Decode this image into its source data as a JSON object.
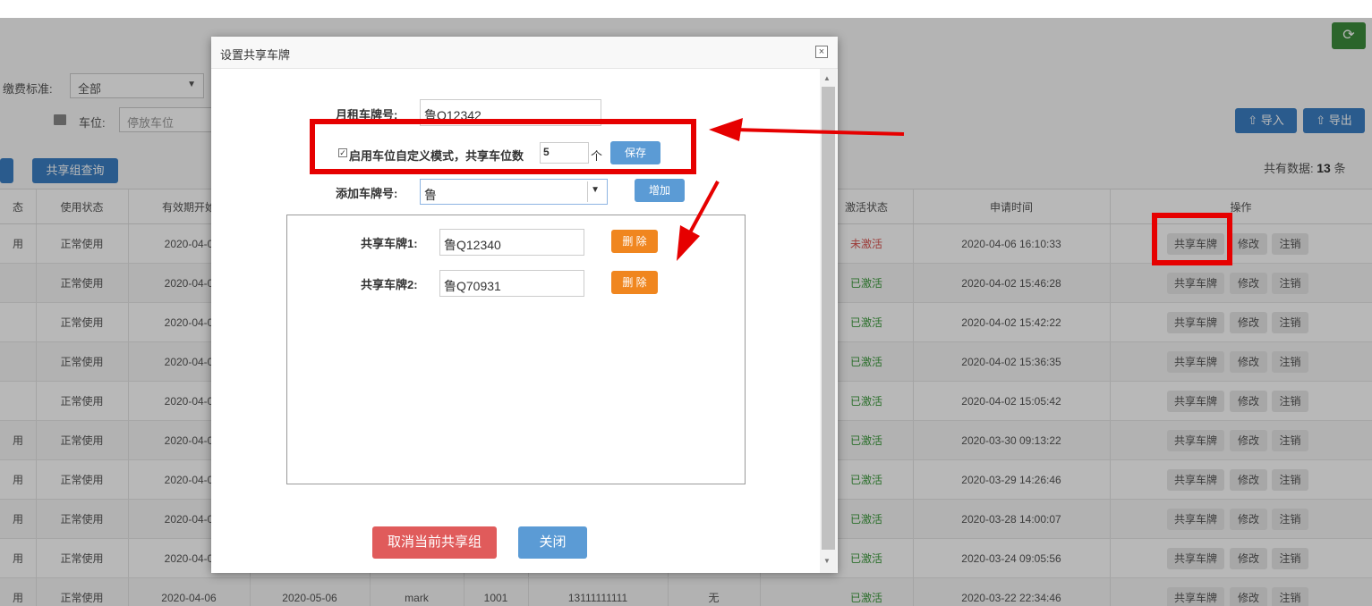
{
  "filters": {
    "fee_label": "缴费标准:",
    "fee_value": "全部",
    "space_label": "车位:",
    "space_placeholder": "停放车位"
  },
  "toolbar": {
    "group_query": "共享组查询",
    "import": "导入",
    "export": "导出",
    "total_label": "共有数据:",
    "total_count": "13",
    "total_unit": "条"
  },
  "table": {
    "headers": {
      "status_fragment": "态",
      "use_status": "使用状态",
      "valid_start": "有效期开始",
      "activation": "激活状态",
      "apply_time": "申请时间",
      "ops": "操作"
    },
    "rows": [
      {
        "f": "用",
        "use": "正常使用",
        "start": "2020-04-0",
        "act": "未激活",
        "act_color": "red",
        "time": "2020-04-06 16:10:33"
      },
      {
        "f": "",
        "use": "正常使用",
        "start": "2020-04-0",
        "act": "已激活",
        "act_color": "green",
        "time": "2020-04-02 15:46:28"
      },
      {
        "f": "",
        "use": "正常使用",
        "start": "2020-04-0",
        "act": "已激活",
        "act_color": "green",
        "time": "2020-04-02 15:42:22"
      },
      {
        "f": "",
        "use": "正常使用",
        "start": "2020-04-0",
        "act": "已激活",
        "act_color": "green",
        "time": "2020-04-02 15:36:35"
      },
      {
        "f": "",
        "use": "正常使用",
        "start": "2020-04-0",
        "act": "已激活",
        "act_color": "green",
        "time": "2020-04-02 15:05:42"
      },
      {
        "f": "用",
        "use": "正常使用",
        "start": "2020-04-0",
        "act": "已激活",
        "act_color": "green",
        "time": "2020-03-30 09:13:22"
      },
      {
        "f": "用",
        "use": "正常使用",
        "start": "2020-04-0",
        "act": "已激活",
        "act_color": "green",
        "time": "2020-03-29 14:26:46"
      },
      {
        "f": "用",
        "use": "正常使用",
        "start": "2020-04-0",
        "act": "已激活",
        "act_color": "green",
        "time": "2020-03-28 14:00:07"
      },
      {
        "f": "用",
        "use": "正常使用",
        "start": "2020-04-0",
        "act": "已激活",
        "act_color": "green",
        "time": "2020-03-24 09:05:56"
      },
      {
        "f": "用",
        "use": "正常使用",
        "start": "2020-04-06",
        "end": "2020-05-06",
        "name": "mark",
        "space": "1001",
        "phone": "13111111111",
        "remark": "无",
        "act": "已激活",
        "act_color": "green",
        "time": "2020-03-22 22:34:46"
      }
    ],
    "op_labels": {
      "share": "共享车牌",
      "edit": "修改",
      "cancel": "注销"
    }
  },
  "modal": {
    "title": "设置共享车牌",
    "monthly_label": "月租车牌号:",
    "monthly_value": "鲁Q12342",
    "custom_mode_label": "启用车位自定义模式，共享车位数",
    "custom_mode_checked": true,
    "share_count": "5",
    "share_unit": "个",
    "save": "保存",
    "add_label": "添加车牌号:",
    "add_value": "鲁",
    "add_button": "增加",
    "shared": [
      {
        "label": "共享车牌1:",
        "value": "鲁Q12340",
        "delete": "删 除"
      },
      {
        "label": "共享车牌2:",
        "value": "鲁Q70931",
        "delete": "删 除"
      }
    ],
    "cancel_group": "取消当前共享组",
    "close": "关闭"
  },
  "colors": {
    "annotation_red": "#e60000",
    "primary_blue": "#3b7fc4",
    "delete_orange": "#f0861f",
    "cancel_red": "#e05b5b"
  }
}
